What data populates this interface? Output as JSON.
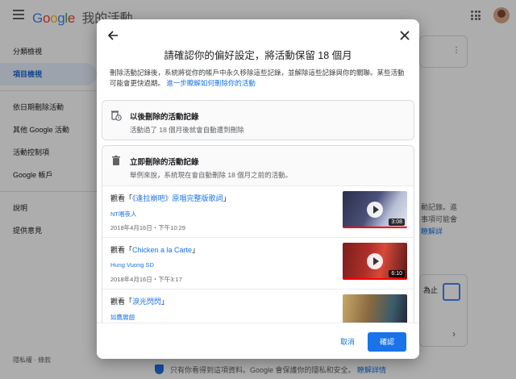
{
  "app": {
    "logo_letters": [
      "G",
      "o",
      "o",
      "g",
      "l",
      "e"
    ],
    "title": "我的活動"
  },
  "sidebar": {
    "items": [
      {
        "label": "分類檢視"
      },
      {
        "label": "項目檢視",
        "active": true
      },
      {
        "label": "依日期刪除活動"
      },
      {
        "label": "其他 Google 活動"
      },
      {
        "label": "活動控制項"
      },
      {
        "label": "Google 帳戶"
      },
      {
        "label": "說明"
      },
      {
        "label": "提供意見"
      }
    ],
    "footer": "隱私權 · 條款"
  },
  "background": {
    "right_text_1": "動記錄。進",
    "right_text_2": "事項可能會",
    "right_link": "瞭解詳",
    "right_card_text": "為止",
    "bottom_note": "只有你看得到這項資料。Google 會保護你的隱私和安全。",
    "bottom_link": "瞭解詳情"
  },
  "dialog": {
    "title": "請確認你的偏好設定，將活動保留 18 個月",
    "description": "刪除活動記錄後，系統將從你的帳戶中永久移除這些記錄，並解除這些記錄與你的關聯。某些活動可能會更快過期。",
    "learn_more": "進一步瞭解如何刪除你的活動",
    "option_future": {
      "title": "以後刪除的活動記錄",
      "subtitle": "活動過了 18 個月後就會自動遭到刪除",
      "icon": "schedule-delete-icon"
    },
    "option_now": {
      "title": "立即刪除的活動記錄",
      "subtitle": "舉例來說，系統現在會自動刪除 18 個月之前的活動。",
      "icon": "trash-icon"
    },
    "activities": [
      {
        "prefix": "觀看「",
        "title": "《逢拉崩吧》原唱完整版歌詞",
        "suffix": "」",
        "channel": "NT唱夜人",
        "date": "2018年4月16日・下午10:29",
        "duration": "3:08",
        "colors": [
          "#2a2f4a",
          "#b6bdd6"
        ]
      },
      {
        "prefix": "觀看「",
        "title": "Chicken a la Carte",
        "suffix": "」",
        "channel": "Hung Vuong SD",
        "date": "2018年4月16日・下午3:17",
        "duration": "6:10",
        "colors": [
          "#7a1e1e",
          "#d84a3a"
        ]
      },
      {
        "prefix": "觀看「",
        "title": "淚光閃閃",
        "suffix": "」",
        "channel": "如鷹展翅",
        "date": "",
        "duration": "",
        "colors": [
          "#c9a86a",
          "#3a5a6a"
        ]
      }
    ],
    "cancel_label": "取消",
    "confirm_label": "確認"
  }
}
